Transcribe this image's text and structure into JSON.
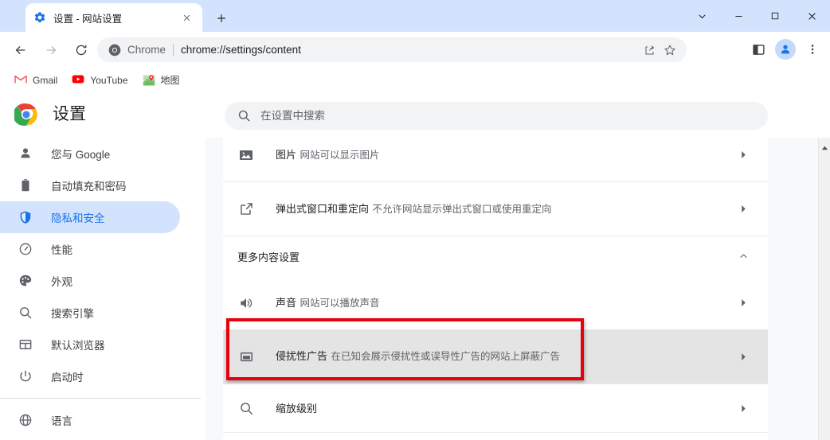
{
  "window": {
    "controls": [
      {
        "name": "chevron-down",
        "label": "⌄"
      },
      {
        "name": "minimize",
        "label": "─"
      },
      {
        "name": "maximize",
        "label": "□"
      },
      {
        "name": "close",
        "label": "✕"
      }
    ]
  },
  "tab": {
    "title": "设置 - 网站设置",
    "favicon": "gear-icon",
    "close_label": "✕",
    "newtab_label": "+"
  },
  "toolbar": {
    "back_label": "←",
    "forward_label": "→",
    "reload_label": "↻",
    "omnibox": {
      "scheme_label": "Chrome",
      "url": "chrome://settings/content",
      "icon": "chrome-icon"
    },
    "share_icon": "share-icon",
    "bookmark_icon": "star-icon",
    "sidepanel_icon": "side-panel-icon",
    "profile_icon": "avatar-icon",
    "menu_icon": "three-dot-menu-icon"
  },
  "bookmarks": [
    {
      "label": "Gmail",
      "icon": "gmail-icon"
    },
    {
      "label": "YouTube",
      "icon": "youtube-icon"
    },
    {
      "label": "地图",
      "icon": "maps-icon"
    }
  ],
  "settings": {
    "title": "设置",
    "logo": "chrome-logo",
    "search": {
      "placeholder": "在设置中搜索",
      "value": "",
      "icon": "search-icon"
    }
  },
  "sidebar": {
    "items": [
      {
        "label": "您与 Google",
        "icon": "person-icon",
        "active": false
      },
      {
        "label": "自动填充和密码",
        "icon": "clipboard-icon",
        "active": false
      },
      {
        "label": "隐私和安全",
        "icon": "shield-icon",
        "active": true
      },
      {
        "label": "性能",
        "icon": "speedometer-icon",
        "active": false
      },
      {
        "label": "外观",
        "icon": "palette-icon",
        "active": false
      },
      {
        "label": "搜索引擎",
        "icon": "search-icon",
        "active": false
      },
      {
        "label": "默认浏览器",
        "icon": "browser-window-icon",
        "active": false
      },
      {
        "label": "启动时",
        "icon": "power-icon",
        "active": false
      }
    ],
    "items_after_divider": [
      {
        "label": "语言",
        "icon": "globe-icon",
        "active": false
      }
    ]
  },
  "content": {
    "rows_top": [
      {
        "title": "图片",
        "subtitle": "网站可以显示图片",
        "icon": "image-icon",
        "arrow": "chevron-right-icon"
      },
      {
        "title": "弹出式窗口和重定向",
        "subtitle": "不允许网站显示弹出式窗口或使用重定向",
        "icon": "external-link-icon",
        "arrow": "chevron-right-icon"
      }
    ],
    "section": {
      "title": "更多内容设置",
      "arrow": "chevron-up-icon"
    },
    "rows_bottom": [
      {
        "title": "声音",
        "subtitle": "网站可以播放声音",
        "icon": "volume-icon",
        "arrow": "chevron-right-icon",
        "highlighted": false
      },
      {
        "title": "侵扰性广告",
        "subtitle": "在已知会展示侵扰性或误导性广告的网站上屏蔽广告",
        "icon": "ad-block-icon",
        "arrow": "chevron-right-icon",
        "highlighted": true
      },
      {
        "title": "缩放级别",
        "subtitle": "",
        "icon": "zoom-icon",
        "arrow": "chevron-right-icon",
        "highlighted": false
      }
    ]
  },
  "scrollbar": {
    "up_arrow": "scroll-up-arrow-icon"
  },
  "colors": {
    "titlebar": "#d3e3fd",
    "accent": "#1a73e8",
    "highlight_row": "#e4e4e4",
    "annotation": "#e8000d",
    "content_bg": "#f8f9fa"
  }
}
